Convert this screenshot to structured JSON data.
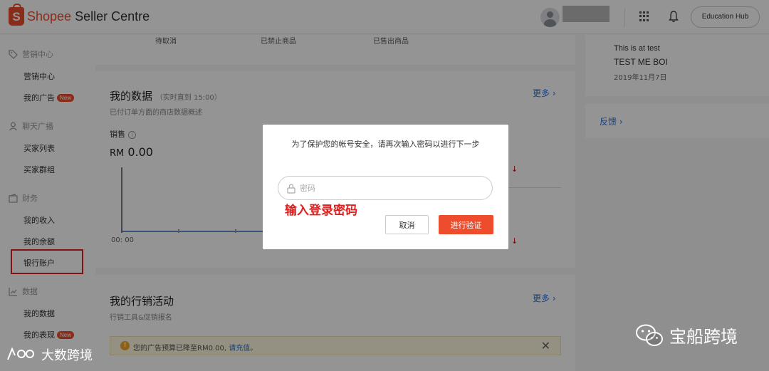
{
  "header": {
    "brand_shopee": "Shopee",
    "brand_rest": " Seller Centre",
    "education_hub": "Education Hub"
  },
  "sidebar": {
    "sections": [
      {
        "label": "营销中心",
        "icon": "tag-icon"
      },
      {
        "label": "聊天广播",
        "icon": "user-icon"
      },
      {
        "label": "财务",
        "icon": "wallet-icon"
      },
      {
        "label": "数据",
        "icon": "chart-icon"
      }
    ],
    "items": {
      "marketing_center": "营销中心",
      "my_ads": "我的广告",
      "buyer_list": "买家列表",
      "buyer_groups": "买家群组",
      "my_income": "我的收入",
      "my_balance": "我的余额",
      "bank_account": "银行账户",
      "my_data": "我的数据",
      "my_performance": "我的表现"
    },
    "new_badge": "New"
  },
  "stats_row": {
    "labels": [
      "待取消",
      "已禁止商品",
      "已售出商品"
    ]
  },
  "my_data_card": {
    "title": "我的数据",
    "title_note": "（实时直到 15:00）",
    "subtitle": "已付订单方面的商店数据概述",
    "more": "更多 ›",
    "sales_label": "销售",
    "info_icon": "i",
    "currency": "RM",
    "sales_value": "0.00",
    "chart_start_time": "00: 00",
    "trend_arrow": "↓"
  },
  "marketing_card": {
    "title": "我的行销活动",
    "subtitle": "行销工具&促销报名",
    "more": "更多 ›",
    "banner_text": "您的广告预算已降至RM0.00, ",
    "banner_link": "请充值",
    "banner_end": "。",
    "close": "✕"
  },
  "notes_card": {
    "title": "This is at test",
    "body": "TEST ME BOI",
    "date": "2019年11月7日"
  },
  "feedback_card": {
    "label": "反馈 ›"
  },
  "modal": {
    "message": "为了保护您的帐号安全，请再次输入密码以进行下一步",
    "password_placeholder": "密码",
    "annotation": "输入登录密码",
    "cancel": "取消",
    "verify": "进行验证"
  },
  "watermarks": {
    "right": "宝船跨境",
    "left": "大数跨境"
  },
  "colors": {
    "brand": "#ee4d2d",
    "link": "#2673dd",
    "annotation": "#e02020"
  }
}
